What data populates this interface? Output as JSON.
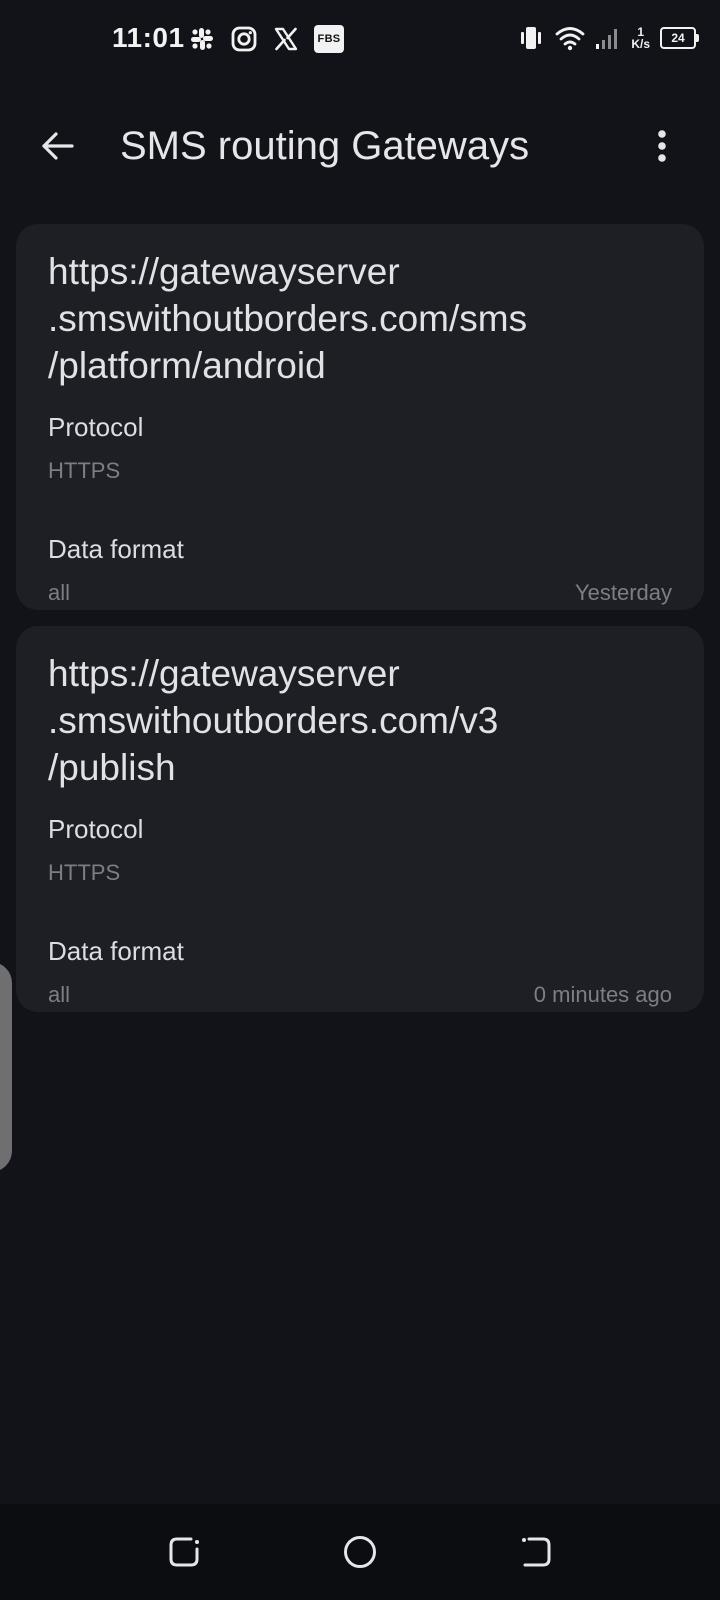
{
  "status_bar": {
    "time": "11:01",
    "left_icons": [
      "slack-icon",
      "instagram-icon",
      "x-icon",
      "fbs-icon"
    ],
    "fbs_label": "FBS",
    "net_speed_value": "1",
    "net_speed_unit": "K/s",
    "battery_level": "24",
    "right_icons": [
      "vibrate-icon",
      "wifi-icon",
      "signal-icon"
    ]
  },
  "app_bar": {
    "title": "SMS routing Gateways",
    "back_icon": "arrow-left-icon",
    "menu_icon": "more-vertical-icon"
  },
  "gateways": [
    {
      "url_lines": [
        "https://gatewayserver",
        ".smswithoutborders.com/sms",
        "/platform/android"
      ],
      "protocol_label": "Protocol",
      "protocol_value": "HTTPS",
      "format_label": "Data format",
      "format_value": "all",
      "time": "Yesterday"
    },
    {
      "url_lines": [
        "https://gatewayserver",
        ".smswithoutborders.com/v3",
        "/publish"
      ],
      "protocol_label": "Protocol",
      "protocol_value": "HTTPS",
      "format_label": "Data format",
      "format_value": "all",
      "time": "0 minutes ago"
    }
  ],
  "nav_bar": {
    "buttons": [
      "recents-icon",
      "home-icon",
      "back-icon"
    ]
  }
}
